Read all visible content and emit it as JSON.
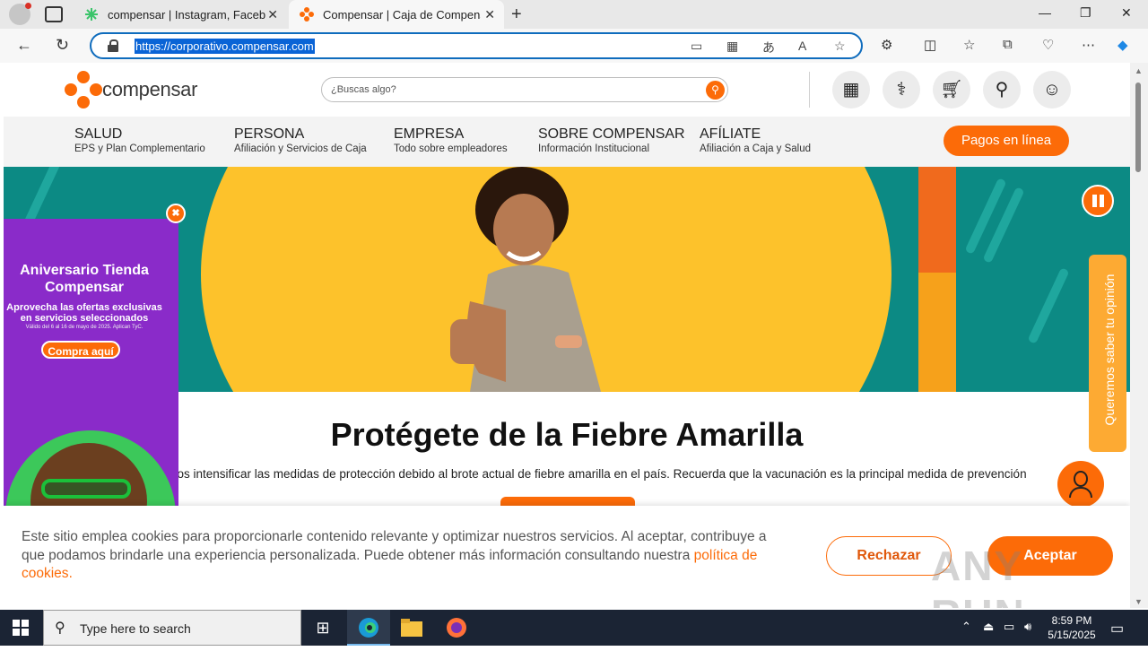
{
  "browser": {
    "tabs": [
      {
        "label": "compensar | Instagram, Facebook",
        "active": false
      },
      {
        "label": "Compensar | Caja de Compensación",
        "active": true
      }
    ],
    "url": "https://corporativo.compensar.com",
    "accent_color": "#0f6cbd"
  },
  "site": {
    "logo_text": "compensar",
    "search_placeholder": "¿Buscas algo?",
    "header_icons": [
      "calendar-icon",
      "stethoscope-icon",
      "cart-icon",
      "location-pin-icon",
      "user-account-icon"
    ],
    "nav": [
      {
        "title": "SALUD",
        "subtitle": "EPS y Plan Complementario"
      },
      {
        "title": "PERSONA",
        "subtitle": "Afiliación y Servicios de Caja"
      },
      {
        "title": "EMPRESA",
        "subtitle": "Todo sobre empleadores"
      },
      {
        "title": "SOBRE COMPENSAR",
        "subtitle": "Información Institucional"
      },
      {
        "title": "AFÍLIATE",
        "subtitle": "Afiliación a Caja y Salud"
      }
    ],
    "payments_button": "Pagos en línea",
    "brand_color": "#fc6b08",
    "headline": "Protégete de la Fiebre Amarilla",
    "subline": "nos intensificar las medidas de protección debido al brote actual de fiebre amarilla en el país. Recuerda que la vacunación es la principal medida de prevención",
    "promo": {
      "title": "Aniversario Tienda Compensar",
      "subtitle": "Aprovecha las ofertas exclusivas en servicios seleccionados",
      "fine_print": "Válido del 6 al 16 de mayo de 2025. Aplican TyC.",
      "button": "Compra aquí",
      "close": "✖"
    },
    "opinion_tab": "Queremos saber tu opinión",
    "cookies": {
      "text": "Este sitio emplea cookies para proporcionarle contenido relevante y optimizar nuestros servicios. Al aceptar, contribuye a que podamos brindarle una experiencia personalizada. Puede obtener más información consultando nuestra ",
      "link": "política de cookies",
      "end": ".",
      "reject": "Rechazar",
      "accept": "Aceptar"
    },
    "watermark": "ANY RUN"
  },
  "taskbar": {
    "search_placeholder": "Type here to search",
    "time": "8:59 PM",
    "date": "5/15/2025"
  }
}
